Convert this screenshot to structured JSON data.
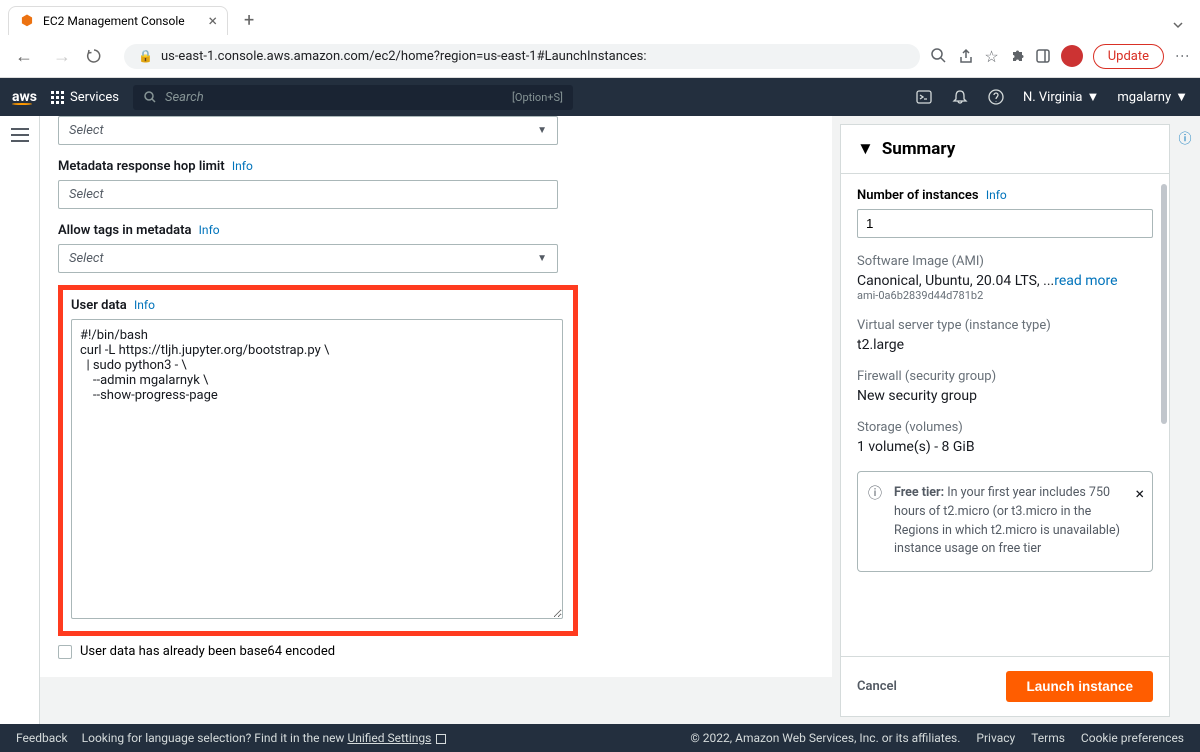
{
  "browser": {
    "tab_title": "EC2 Management Console",
    "url": "us-east-1.console.aws.amazon.com/ec2/home?region=us-east-1#LaunchInstances:",
    "update_label": "Update"
  },
  "awsnav": {
    "services_label": "Services",
    "search_placeholder": "Search",
    "search_shortcut": "[Option+S]",
    "region": "N. Virginia",
    "account": "mgalarny"
  },
  "form": {
    "select_placeholder": "Select",
    "metadata_hop_label": "Metadata response hop limit",
    "allow_tags_label": "Allow tags in metadata",
    "user_data_label": "User data",
    "info_label": "Info",
    "user_data_value": "#!/bin/bash\ncurl -L https://tljh.jupyter.org/bootstrap.py \\\n  | sudo python3 - \\\n    --admin mgalarnyk \\\n    --show-progress-page",
    "base64_label": "User data has already been base64 encoded"
  },
  "summary": {
    "title": "Summary",
    "num_instances_label": "Number of instances",
    "num_instances_value": "1",
    "ami_label": "Software Image (AMI)",
    "ami_value": "Canonical, Ubuntu, 20.04 LTS, ...",
    "ami_read_more": "read more",
    "ami_id": "ami-0a6b2839d44d781b2",
    "instance_type_label": "Virtual server type (instance type)",
    "instance_type_value": "t2.large",
    "firewall_label": "Firewall (security group)",
    "firewall_value": "New security group",
    "storage_label": "Storage (volumes)",
    "storage_value": "1 volume(s) - 8 GiB",
    "free_tier_text": "In your first year includes 750 hours of t2.micro (or t3.micro in the Regions in which t2.micro is unavailable) instance usage on free tier",
    "free_tier_label": "Free tier:",
    "cancel_label": "Cancel",
    "launch_label": "Launch instance"
  },
  "footer": {
    "feedback": "Feedback",
    "lang_text": "Looking for language selection? Find it in the new",
    "unified_settings": "Unified Settings",
    "copyright": "© 2022, Amazon Web Services, Inc. or its affiliates.",
    "privacy": "Privacy",
    "terms": "Terms",
    "cookie": "Cookie preferences"
  }
}
